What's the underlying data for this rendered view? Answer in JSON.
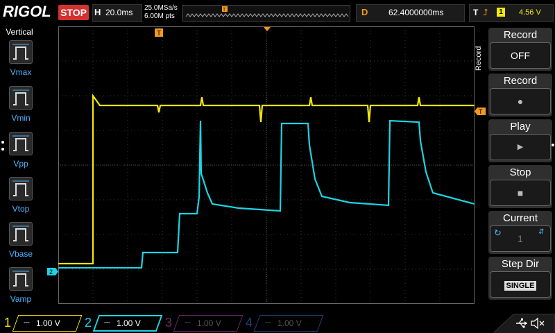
{
  "header": {
    "logo": "RIGOL",
    "run_status": "STOP",
    "horizontal": {
      "key": "H",
      "value": "20.0ms"
    },
    "sample_rate": "25.0MSa/s",
    "memory_depth": "6.00M pts",
    "delay": {
      "key": "D",
      "value": "62.4000000ms"
    },
    "trigger": {
      "key": "T",
      "edge": "rising-edge-icon",
      "source": "1",
      "level": "4.56 V"
    }
  },
  "left_panel": {
    "title": "Vertical",
    "items": [
      "Vmax",
      "Vmin",
      "Vpp",
      "Vtop",
      "Vbase",
      "Vamp"
    ]
  },
  "right_panel": {
    "side_label": "Record",
    "buttons": [
      {
        "title": "Record",
        "value": "OFF"
      },
      {
        "title": "Record",
        "value": "●"
      },
      {
        "title": "Play",
        "value": "▶"
      },
      {
        "title": "Stop",
        "value": "■"
      },
      {
        "title": "Current",
        "value": "1"
      },
      {
        "title": "Step Dir",
        "value": "SINGLE"
      }
    ]
  },
  "markers": {
    "trigger_position": "T",
    "ch2_ground": "2",
    "trigger_level": "T"
  },
  "channels": [
    {
      "number": "1",
      "scale": "1.00 V",
      "color": "#f5e80a",
      "active": true
    },
    {
      "number": "2",
      "scale": "1.00 V",
      "color": "#1fd3e3",
      "active": true
    },
    {
      "number": "3",
      "scale": "1.00 V",
      "color": "#d040c0",
      "active": false
    },
    {
      "number": "4",
      "scale": "1.00 V",
      "color": "#2a6de0",
      "active": false
    }
  ],
  "colors": {
    "ch1": "#f5e80a",
    "ch2": "#1fd3e3",
    "trigger": "#f39a1e",
    "stop": "#d43030",
    "accent_blue": "#4fb4ff"
  },
  "status_icons": [
    "usb-icon",
    "sound-muted-icon"
  ]
}
